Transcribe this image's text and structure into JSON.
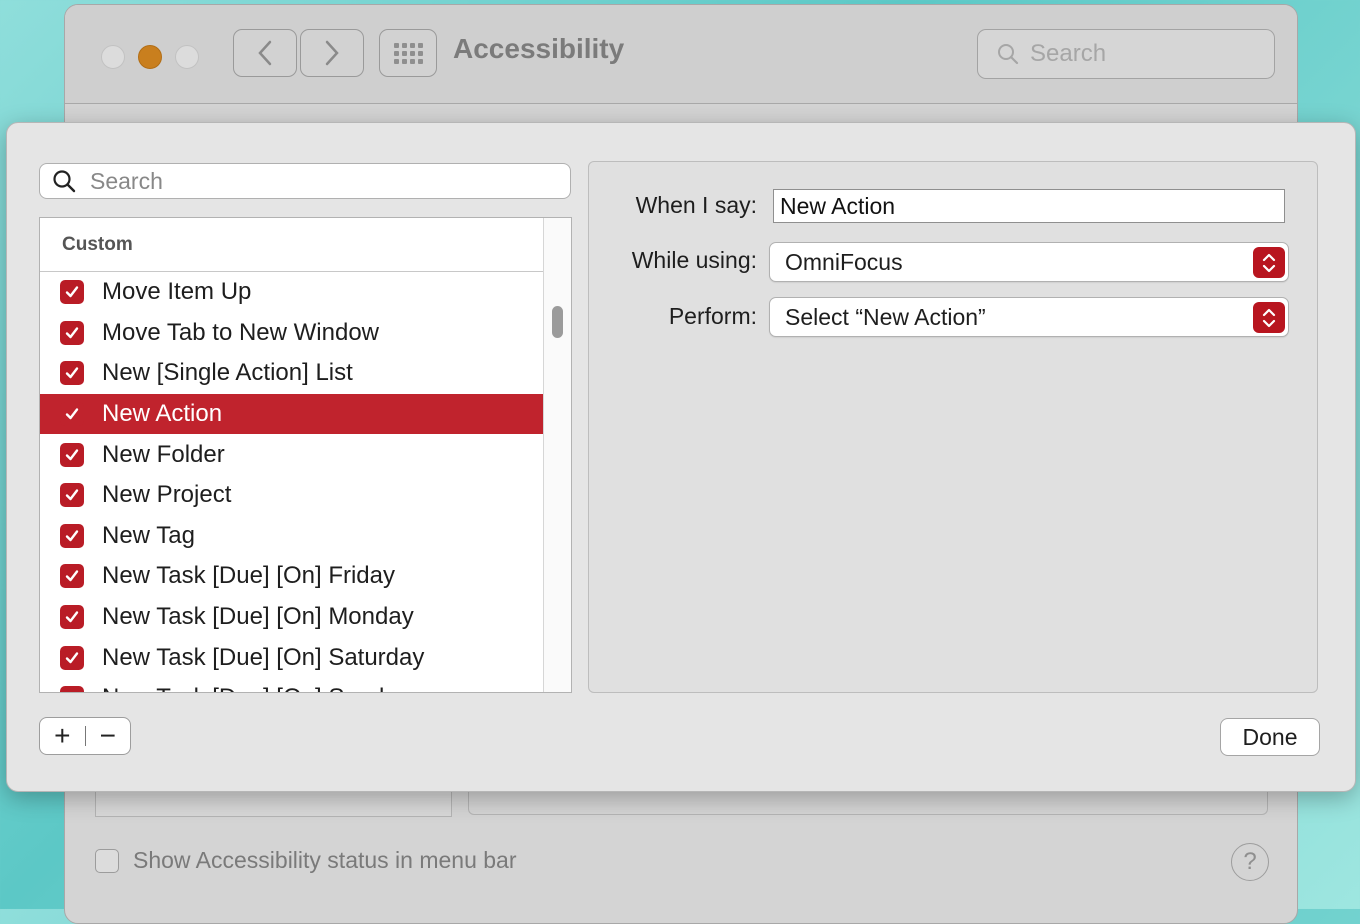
{
  "background_window": {
    "title": "Accessibility",
    "search_placeholder": "Search",
    "status_checkbox_label": "Show Accessibility status in menu bar",
    "help_label": "?"
  },
  "sheet": {
    "search_placeholder": "Search",
    "list_header": "Custom",
    "commands": [
      {
        "label": "Move Item Up",
        "checked": true,
        "selected": false
      },
      {
        "label": "Move Tab to New Window",
        "checked": true,
        "selected": false
      },
      {
        "label": "New [Single Action] List",
        "checked": true,
        "selected": false
      },
      {
        "label": "New Action",
        "checked": true,
        "selected": true
      },
      {
        "label": "New Folder",
        "checked": true,
        "selected": false
      },
      {
        "label": "New Project",
        "checked": true,
        "selected": false
      },
      {
        "label": "New Tag",
        "checked": true,
        "selected": false
      },
      {
        "label": "New Task [Due] [On] Friday",
        "checked": true,
        "selected": false
      },
      {
        "label": "New Task [Due] [On] Monday",
        "checked": true,
        "selected": false
      },
      {
        "label": "New Task [Due] [On] Saturday",
        "checked": true,
        "selected": false
      },
      {
        "label": "New Task [Due] [On] Sunday",
        "checked": true,
        "selected": false
      }
    ],
    "add_label": "+",
    "remove_label": "−",
    "detail": {
      "when_i_say_label": "When I say:",
      "when_i_say_value": "New Action",
      "while_using_label": "While using:",
      "while_using_value": "OmniFocus",
      "perform_label": "Perform:",
      "perform_value": "Select “New Action”"
    },
    "done_label": "Done"
  },
  "colors": {
    "accent": "#c0232d",
    "minimize": "#c97f1e"
  }
}
